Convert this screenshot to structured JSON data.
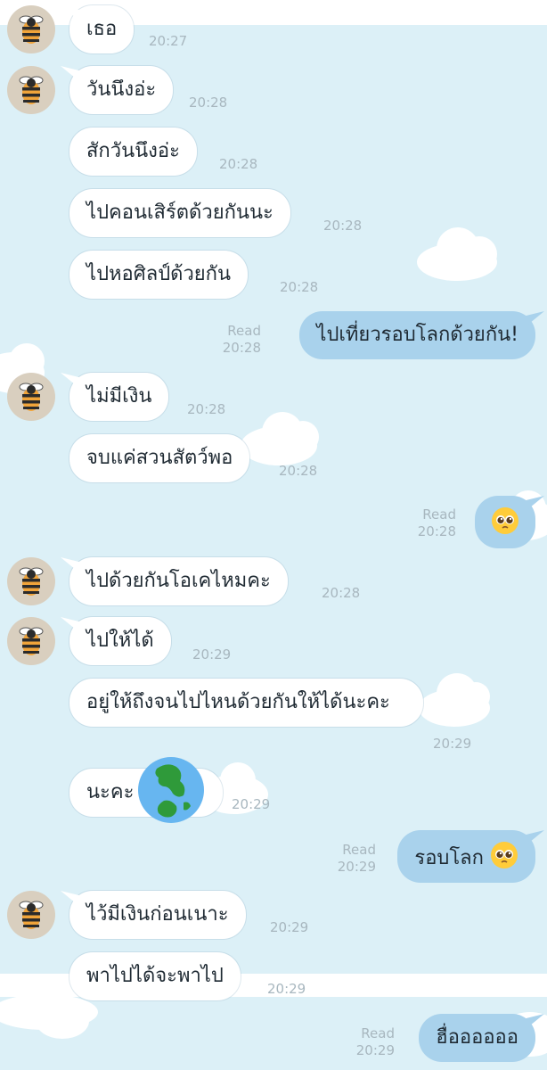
{
  "contact_avatar_icon": "bee-icon",
  "colors": {
    "background": "#dcf0f7",
    "incoming_bubble": "#ffffff",
    "outgoing_bubble": "#a9d2ec",
    "timestamp": "#a8b7bf"
  },
  "messages": [
    {
      "from": "contact",
      "text": "เธอ",
      "time": "20:27"
    },
    {
      "from": "contact",
      "text": "วันนึงอ่ะ",
      "time": "20:28"
    },
    {
      "from": "contact",
      "text": "สักวันนึงอ่ะ",
      "time": "20:28"
    },
    {
      "from": "contact",
      "text": "ไปคอนเสิร์ตด้วยกันนะ",
      "time": "20:28"
    },
    {
      "from": "contact",
      "text": "ไปหอศิลป์ด้วยกัน",
      "time": "20:28"
    },
    {
      "from": "me",
      "text": "ไปเที่ยวรอบโลกด้วยกัน!",
      "read": "Read",
      "time": "20:28"
    },
    {
      "from": "contact",
      "text": "ไม่มีเงิน",
      "time": "20:28"
    },
    {
      "from": "contact",
      "text": "จบแค่สวนสัตว์พอ",
      "time": "20:28"
    },
    {
      "from": "me",
      "emoji": "pleading-face-emoji",
      "read": "Read",
      "time": "20:28"
    },
    {
      "from": "contact",
      "text": "ไปด้วยกันโอเคไหมคะ",
      "time": "20:28"
    },
    {
      "from": "contact",
      "text": "ไปให้ได้",
      "time": "20:29"
    },
    {
      "from": "contact",
      "text": "อยู่ให้ถึงจนไปไหนด้วยกันให้ได้นะคะ",
      "time": "20:29"
    },
    {
      "from": "contact",
      "text": "นะคะ",
      "emoji": "globe-emoji",
      "time": "20:29"
    },
    {
      "from": "me",
      "text": "รอบโลก",
      "emoji": "pleading-face-emoji",
      "read": "Read",
      "time": "20:29"
    },
    {
      "from": "contact",
      "text": "ไว้มีเงินก่อนเนาะ",
      "time": "20:29"
    },
    {
      "from": "contact",
      "text": "พาไปได้จะพาไป",
      "time": "20:29"
    },
    {
      "from": "me",
      "text": "ฮื่ออออออ",
      "read": "Read",
      "time": "20:29"
    }
  ]
}
